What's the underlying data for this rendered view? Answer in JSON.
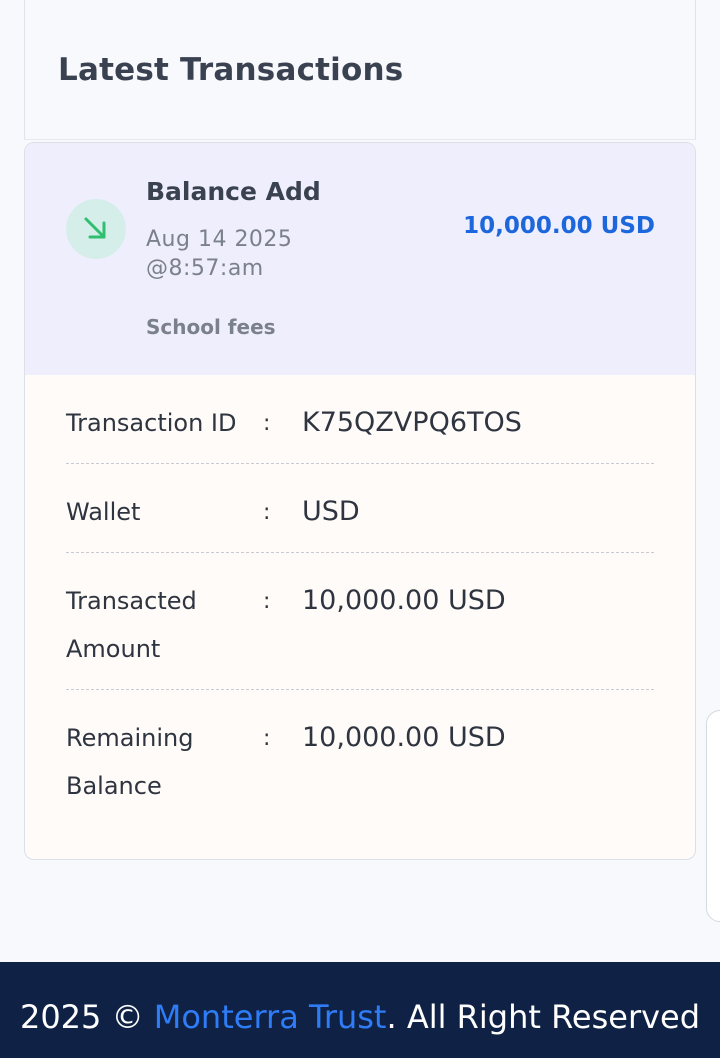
{
  "section": {
    "title": "Latest Transactions"
  },
  "transaction": {
    "title": "Balance Add",
    "date_line1": "Aug 14 2025",
    "date_line2": "@8:57:am",
    "amount": "10,000.00 USD",
    "note": "School fees",
    "icon": "arrow-down-right-icon",
    "colors": {
      "amount": "#1d67dd",
      "icon": "#2fbf71",
      "icon_bg": "#d6eeea",
      "header_bg": "#efeefd"
    }
  },
  "details": [
    {
      "label": "Transaction ID",
      "separator": ":",
      "value": "K75QZVPQ6TOS"
    },
    {
      "label": "Wallet",
      "separator": ":",
      "value": "USD"
    },
    {
      "label": "Transacted Amount",
      "separator": ":",
      "value": "10,000.00 USD"
    },
    {
      "label": "Remaining Balance",
      "separator": ":",
      "value": "10,000.00 USD"
    }
  ],
  "footer": {
    "prefix": "2025 © ",
    "brand": "Monterra Trust",
    "suffix": ". All Right Reserved",
    "colors": {
      "background": "#0f2246",
      "brand": "#2e7cf6"
    }
  }
}
